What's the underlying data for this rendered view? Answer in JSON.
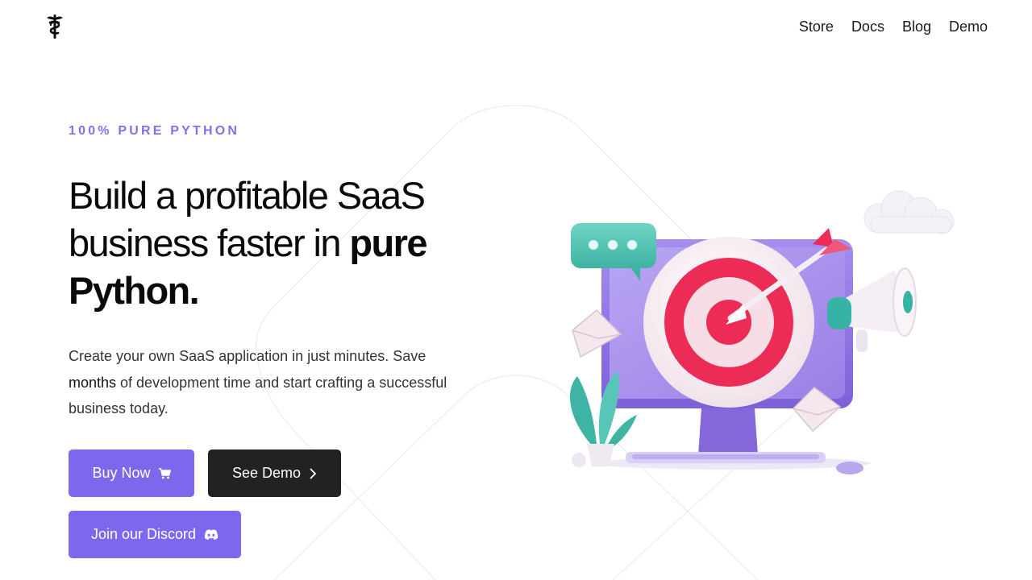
{
  "header": {
    "logo_icon": "caduceus-logo-icon",
    "nav": [
      {
        "label": "Store"
      },
      {
        "label": "Docs"
      },
      {
        "label": "Blog"
      },
      {
        "label": "Demo"
      }
    ]
  },
  "hero": {
    "eyebrow": "100% PURE PYTHON",
    "headline_part1": "Build a profitable SaaS business faster in ",
    "headline_bold": "pure Python.",
    "sub_part1": "Create your own SaaS application in just minutes. Save ",
    "sub_bold": "months",
    "sub_part2": " of development time and start crafting a successful business today.",
    "buttons": {
      "buy_label": "Buy Now",
      "buy_icon": "cart-icon",
      "demo_label": "See Demo",
      "demo_icon": "chevron-right-icon",
      "discord_label": "Join our Discord",
      "discord_icon": "discord-icon"
    },
    "illustration": "computer-target-illustration"
  },
  "colors": {
    "accent": "#7e67ec",
    "eyebrow": "#8b6cf0",
    "dark_button": "#222222"
  }
}
